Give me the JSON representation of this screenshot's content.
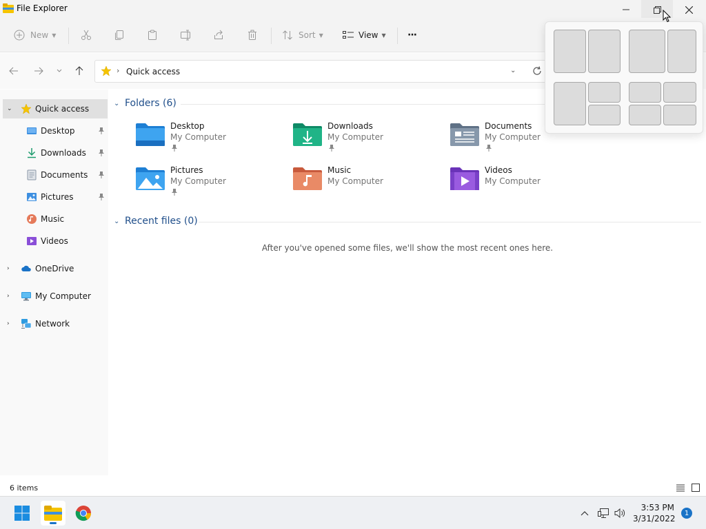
{
  "window": {
    "title": "File Explorer"
  },
  "toolbar": {
    "new_label": "New",
    "sort_label": "Sort",
    "view_label": "View",
    "more_label": "···"
  },
  "address": {
    "path": "Quick access"
  },
  "sidebar": {
    "quick_access": "Quick access",
    "items": [
      {
        "label": "Desktop",
        "icon": "desktop-icon",
        "pinned": true
      },
      {
        "label": "Downloads",
        "icon": "downloads-icon",
        "pinned": true
      },
      {
        "label": "Documents",
        "icon": "documents-icon",
        "pinned": true
      },
      {
        "label": "Pictures",
        "icon": "pictures-icon",
        "pinned": true
      },
      {
        "label": "Music",
        "icon": "music-icon",
        "pinned": false
      },
      {
        "label": "Videos",
        "icon": "videos-icon",
        "pinned": false
      }
    ],
    "roots": [
      {
        "label": "OneDrive",
        "icon": "onedrive-icon"
      },
      {
        "label": "My Computer",
        "icon": "computer-icon"
      },
      {
        "label": "Network",
        "icon": "network-icon"
      }
    ]
  },
  "content": {
    "folders_header": "Folders (6)",
    "folders": [
      {
        "name": "Desktop",
        "location": "My Computer",
        "icon": "desktop-folder-icon"
      },
      {
        "name": "Downloads",
        "location": "My Computer",
        "icon": "downloads-folder-icon"
      },
      {
        "name": "Documents",
        "location": "My Computer",
        "icon": "documents-folder-icon"
      },
      {
        "name": "Pictures",
        "location": "My Computer",
        "icon": "pictures-folder-icon"
      },
      {
        "name": "Music",
        "location": "My Computer",
        "icon": "music-folder-icon"
      },
      {
        "name": "Videos",
        "location": "My Computer",
        "icon": "videos-folder-icon"
      }
    ],
    "recent_header": "Recent files (0)",
    "recent_empty": "After you've opened some files, we'll show the most recent ones here."
  },
  "statusbar": {
    "count": "6 items"
  },
  "taskbar": {
    "time": "3:53 PM",
    "date": "3/31/2022",
    "notifications": "1"
  },
  "colors": {
    "accent": "#1a73c7",
    "header_text": "#1f4e8a",
    "folder_blue": "#3d8fe0",
    "folder_yellow": "#f5c400"
  }
}
